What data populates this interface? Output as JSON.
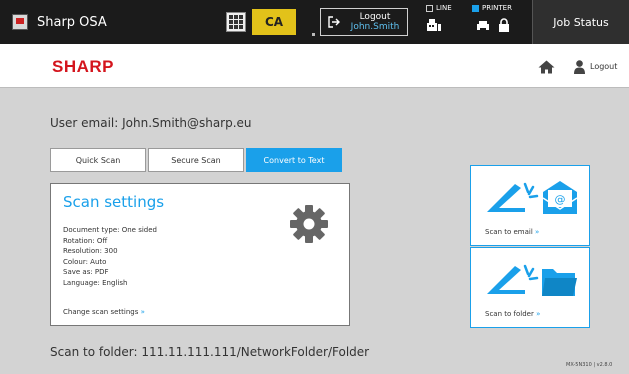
{
  "top_bar": {
    "app_title": "Sharp OSA",
    "language_code": "CA",
    "logout_label": "Logout",
    "logout_user": "John.Smith",
    "line_label": "LINE",
    "printer_label": "PRINTER",
    "job_status_label": "Job Status"
  },
  "header": {
    "logo_text": "SHARP",
    "logout_label": "Logout"
  },
  "main": {
    "user_email_text": "User email: John.Smith@sharp.eu",
    "tabs": [
      {
        "label": "Quick Scan",
        "active": false
      },
      {
        "label": "Secure Scan",
        "active": false
      },
      {
        "label": "Convert to Text",
        "active": true
      }
    ],
    "settings": {
      "title": "Scan settings",
      "items": [
        "Document type: One sided",
        "Rotation: Off",
        "Resolution: 300",
        "Colour: Auto",
        "Save as: PDF",
        "Language: English"
      ],
      "change_link": "Change scan settings",
      "link_arrow": "»"
    },
    "destinations": [
      {
        "label": "Scan to email",
        "arrow": "»",
        "icon": "scan-to-email-icon"
      },
      {
        "label": "Scan to folder",
        "arrow": "»",
        "icon": "scan-to-folder-icon"
      }
    ],
    "scan_to_folder_text": "Scan to folder: 111.11.111.111/NetworkFolder/Folder"
  },
  "footer": {
    "model_version": "MX-5N310 | v2.8.0"
  },
  "colors": {
    "accent": "#1aa0ea",
    "brand": "#d4151d",
    "language_badge": "#e2c21a",
    "topbar": "#1b1b1b",
    "page_background": "#d3d3d3"
  }
}
